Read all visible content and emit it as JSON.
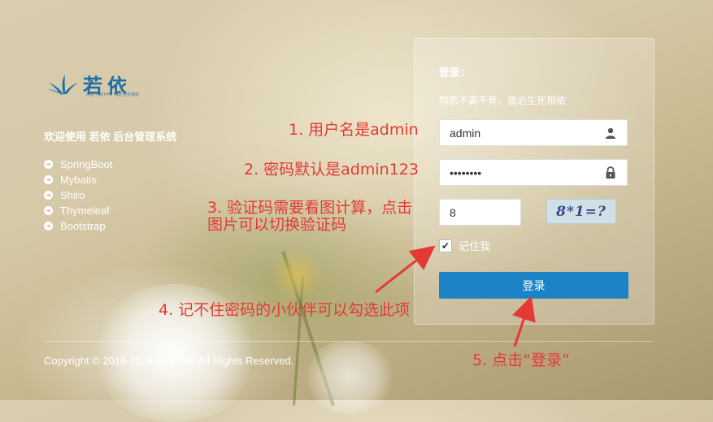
{
  "brand": {
    "name": "若依",
    "slogan": "你若不离不弃，我必生死相依"
  },
  "sidebar": {
    "welcome": "欢迎使用 若依 后台管理系统",
    "features": [
      "SpringBoot",
      "Mybatis",
      "Shiro",
      "Thymeleaf",
      "Bootstrap"
    ]
  },
  "login": {
    "title": "登录：",
    "subtitle": "你若不离不弃，我必生死相依",
    "username": "admin",
    "password": "••••••••",
    "captcha_value": "8",
    "captcha_text": "8*1=?",
    "remember_label": "记住我",
    "remember_checked": true,
    "submit_label": "登录"
  },
  "footer": {
    "copyright": "Copyright © 2018-2024 ruoyi.vip All Rights Reserved."
  },
  "annotations": {
    "a1": "1. 用户名是admin",
    "a2": "2. 密码默认是admin123",
    "a3_line1": "3. 验证码需要看图计算，点击",
    "a3_line2": "图片可以切换验证码",
    "a4": "4. 记不住密码的小伙伴可以勾选此项",
    "a5": "5. 点击“登录”"
  },
  "colors": {
    "accent": "#1c84c6",
    "annotation": "#e53935",
    "brand": "#1d6fa6"
  },
  "icons": {
    "user": "user-icon",
    "lock": "lock-icon",
    "feature_bullet": "circle-arrow-right-icon",
    "check": "check-icon"
  }
}
